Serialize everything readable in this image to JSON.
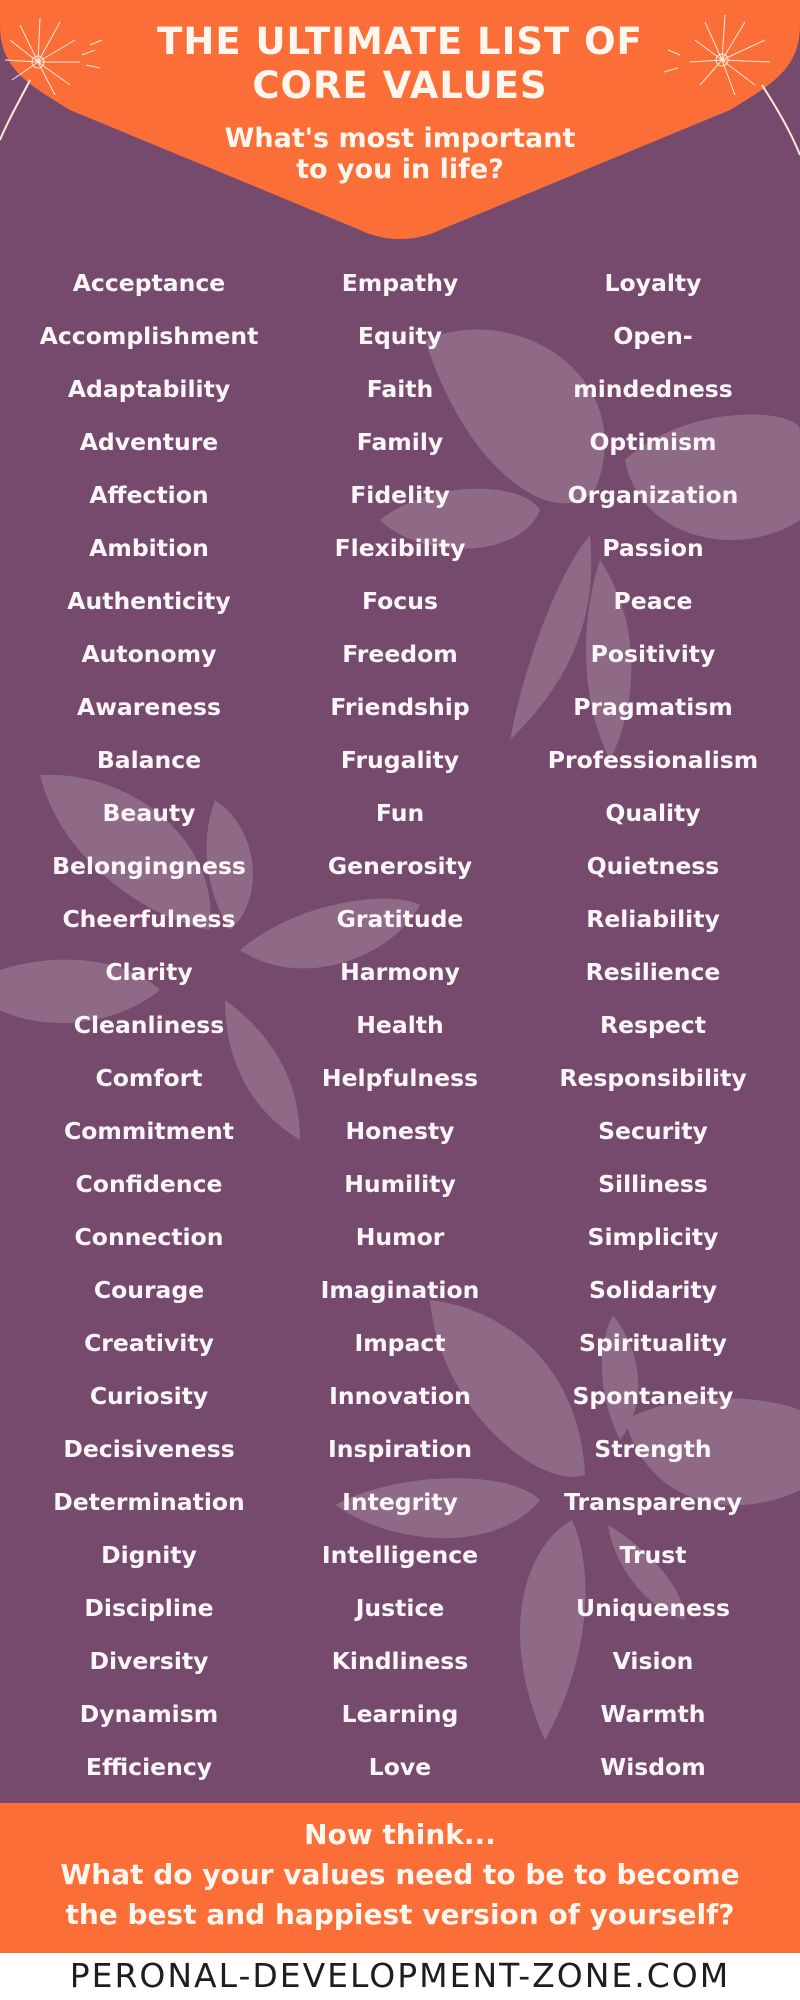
{
  "header": {
    "title_line1": "THE ULTIMATE LIST OF",
    "title_line2": "CORE VALUES",
    "subtitle_line1": "What's most important",
    "subtitle_line2": "to you in life?"
  },
  "colors": {
    "orange": "#fb6e37",
    "purple": "#754a6d",
    "leaf": "#8e6a87",
    "text": "#fdf6f8"
  },
  "values": {
    "column1": [
      "Acceptance",
      "Accomplishment",
      "Adaptability",
      "Adventure",
      "Affection",
      "Ambition",
      "Authenticity",
      "Autonomy",
      "Awareness",
      "Balance",
      "Beauty",
      "Belongingness",
      "Cheerfulness",
      "Clarity",
      "Cleanliness",
      "Comfort",
      "Commitment",
      "Confidence",
      "Connection",
      "Courage",
      "Creativity",
      "Curiosity",
      "Decisiveness",
      "Determination",
      "Dignity",
      "Discipline",
      "Diversity",
      "Dynamism",
      "Efficiency"
    ],
    "column2": [
      "Empathy",
      "Equity",
      "Faith",
      "Family",
      "Fidelity",
      "Flexibility",
      "Focus",
      "Freedom",
      "Friendship",
      "Frugality",
      "Fun",
      "Generosity",
      "Gratitude",
      "Harmony",
      "Health",
      "Helpfulness",
      "Honesty",
      "Humility",
      "Humor",
      "Imagination",
      "Impact",
      "Innovation",
      "Inspiration",
      "Integrity",
      "Intelligence",
      "Justice",
      "Kindliness",
      "Learning",
      "Love"
    ],
    "column3": [
      "Loyalty",
      "Open-",
      "mindedness",
      "Optimism",
      "Organization",
      "Passion",
      "Peace",
      "Positivity",
      "Pragmatism",
      "Professionalism",
      "Quality",
      "Quietness",
      "Reliability",
      "Resilience",
      "Respect",
      "Responsibility",
      "Security",
      "Silliness",
      "Simplicity",
      "Solidarity",
      "Spirituality",
      "Spontaneity",
      "Strength",
      "Transparency",
      "Trust",
      "Uniqueness",
      "Vision",
      "Warmth",
      "Wisdom"
    ]
  },
  "footer": {
    "line1": "Now think...",
    "line2": "What do your values need to be to become",
    "line3": "the best and happiest version of yourself?"
  },
  "site": "PERONAL-DEVELOPMENT-ZONE.COM"
}
